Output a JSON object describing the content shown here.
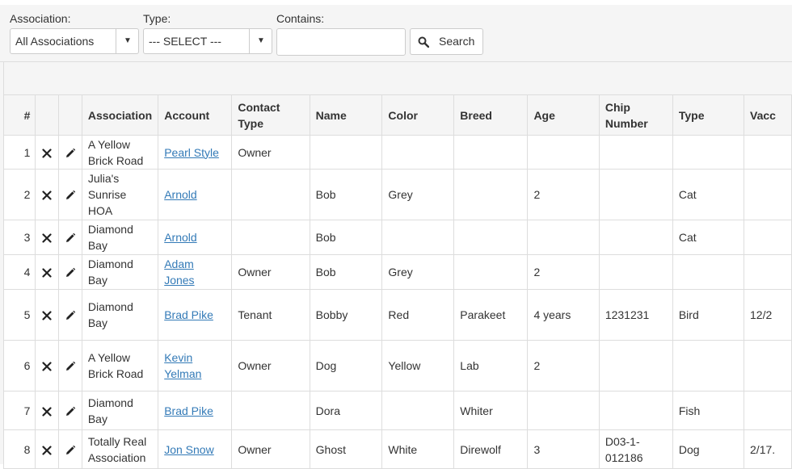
{
  "filters": {
    "association_label": "Association:",
    "association_value": "All Associations",
    "type_label": "Type:",
    "type_value": "--- SELECT ---",
    "contains_label": "Contains:",
    "contains_value": "",
    "search_label": "Search"
  },
  "table": {
    "columns": [
      "#",
      "",
      "",
      "Association",
      "Account",
      "Contact Type",
      "Name",
      "Color",
      "Breed",
      "Age",
      "Chip Number",
      "Type",
      "Vacc"
    ],
    "rows": [
      {
        "num": "1",
        "association": "A Yellow Brick Road",
        "account": "Pearl Style",
        "contact_type": "Owner",
        "name": "",
        "color": "",
        "breed": "",
        "age": "",
        "chip": "",
        "type": "",
        "vacc": ""
      },
      {
        "num": "2",
        "association": "Julia's Sunrise HOA",
        "account": "Arnold",
        "contact_type": "",
        "name": "Bob",
        "color": "Grey",
        "breed": "",
        "age": "2",
        "chip": "",
        "type": "Cat",
        "vacc": ""
      },
      {
        "num": "3",
        "association": "Diamond Bay",
        "account": "Arnold",
        "contact_type": "",
        "name": "Bob",
        "color": "",
        "breed": "",
        "age": "",
        "chip": "",
        "type": "Cat",
        "vacc": ""
      },
      {
        "num": "4",
        "association": "Diamond Bay",
        "account": "Adam Jones",
        "contact_type": "Owner",
        "name": "Bob",
        "color": "Grey",
        "breed": "",
        "age": "2",
        "chip": "",
        "type": "",
        "vacc": ""
      },
      {
        "num": "5",
        "association": "Diamond Bay",
        "account": "Brad Pike",
        "contact_type": "Tenant",
        "name": "Bobby",
        "color": "Red",
        "breed": "Parakeet",
        "age": "4 years",
        "chip": "1231231",
        "type": "Bird",
        "vacc": "12/2"
      },
      {
        "num": "6",
        "association": "A Yellow Brick Road",
        "account": "Kevin Yelman",
        "contact_type": "Owner",
        "name": "Dog",
        "color": "Yellow",
        "breed": "Lab",
        "age": "2",
        "chip": "",
        "type": "",
        "vacc": ""
      },
      {
        "num": "7",
        "association": "Diamond Bay",
        "account": "Brad Pike",
        "contact_type": "",
        "name": "Dora",
        "color": "",
        "breed": "Whiter",
        "age": "",
        "chip": "",
        "type": "Fish",
        "vacc": ""
      },
      {
        "num": "8",
        "association": "Totally Real Association",
        "account": "Jon Snow",
        "contact_type": "Owner",
        "name": "Ghost",
        "color": "White",
        "breed": "Direwolf",
        "age": "3",
        "chip": "D03-1-012186",
        "type": "Dog",
        "vacc": "2/17."
      }
    ]
  },
  "icons": {
    "delete": "close-icon",
    "edit": "pencil-icon",
    "search": "search-icon",
    "dropdown": "caret-down-icon"
  },
  "colors": {
    "link": "#337ab7",
    "header_bg": "#f5f5f5",
    "border": "#dddddd"
  }
}
